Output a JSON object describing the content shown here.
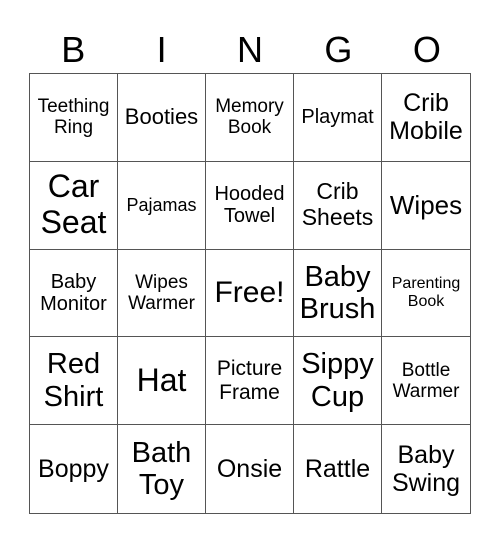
{
  "header": {
    "letters": [
      "B",
      "I",
      "N",
      "G",
      "O"
    ]
  },
  "card": {
    "cells": [
      "Teething\nRing",
      "Booties",
      "Memory\nBook",
      "Playmat",
      "Crib\nMobile",
      "Car\nSeat",
      "Pajamas",
      "Hooded\nTowel",
      "Crib\nSheets",
      "Wipes",
      "Baby\nMonitor",
      "Wipes\nWarmer",
      "Free!",
      "Baby\nBrush",
      "Parenting\nBook",
      "Red\nShirt",
      "Hat",
      "Picture\nFrame",
      "Sippy\nCup",
      "Bottle\nWarmer",
      "Boppy",
      "Bath\nToy",
      "Onsie",
      "Rattle",
      "Baby\nSwing"
    ]
  }
}
